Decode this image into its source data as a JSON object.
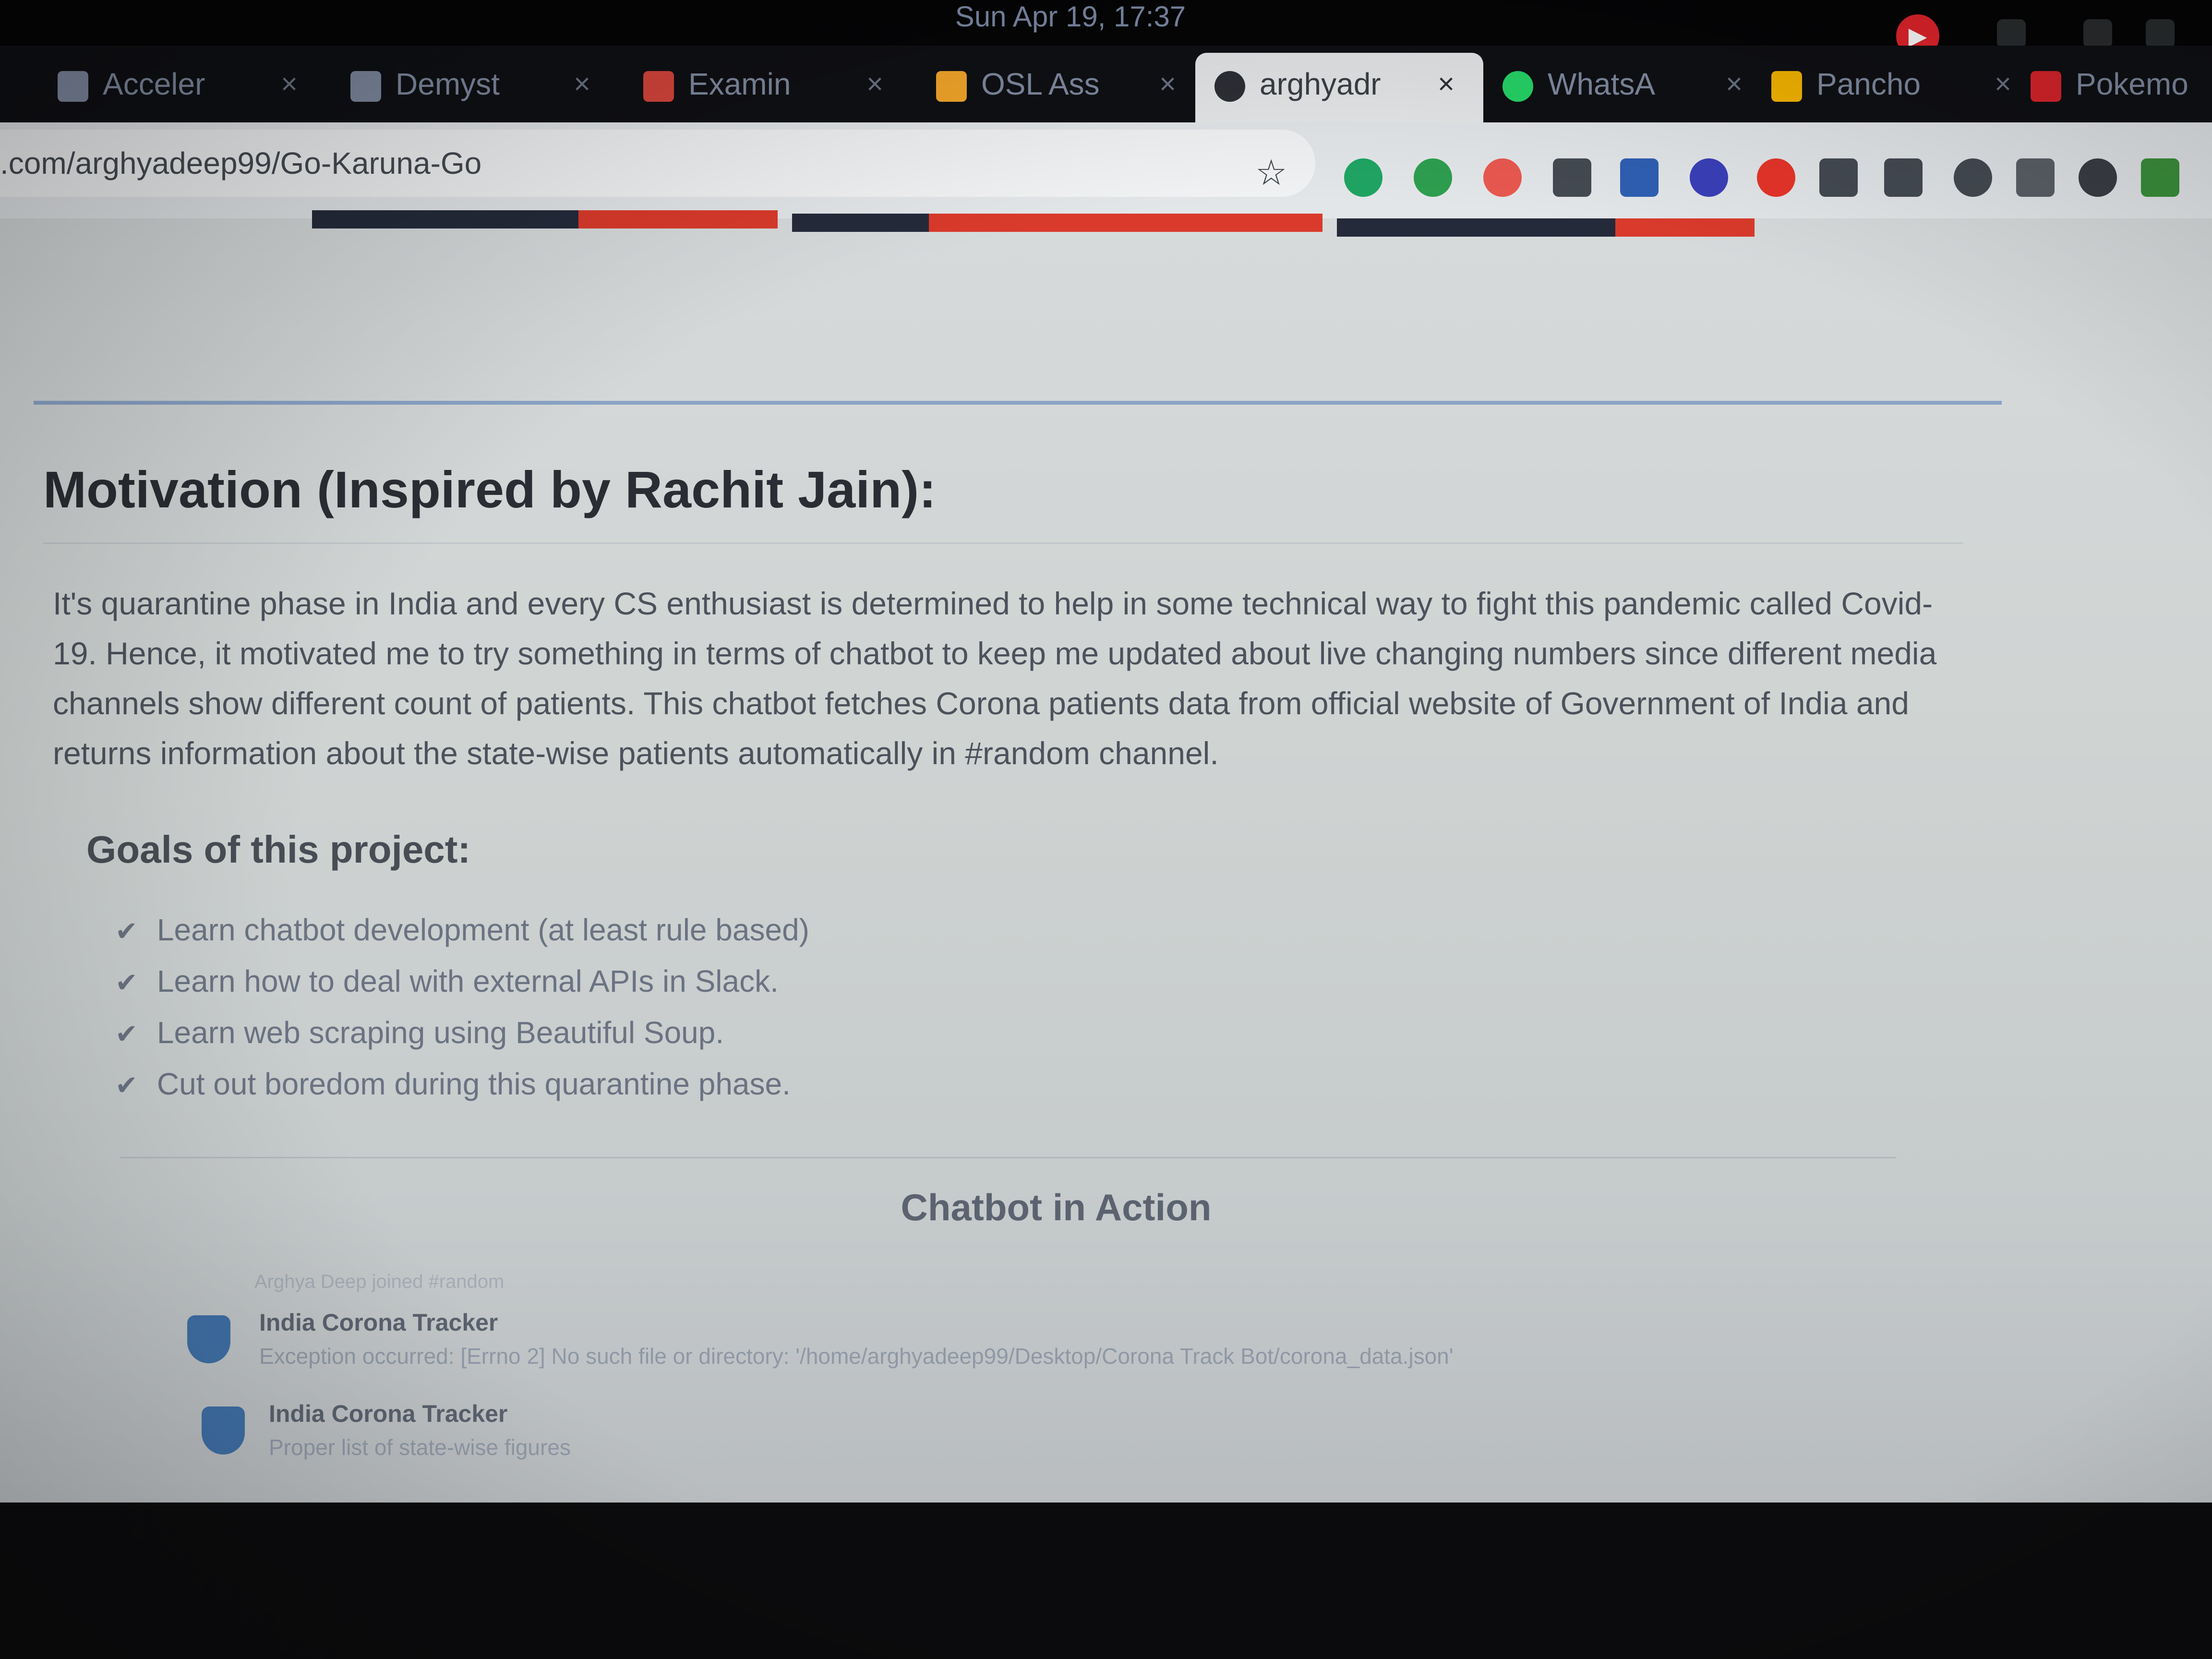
{
  "system": {
    "clock": "Sun Apr 19, 17:37"
  },
  "tabs": [
    {
      "label": "Acceler",
      "favicon_color": "#7f8aa0"
    },
    {
      "label": "Demyst",
      "favicon_color": "#7f8aa0"
    },
    {
      "label": "Examin",
      "favicon_color": "#d5453b"
    },
    {
      "label": "OSL Ass",
      "favicon_color": "#f3a62a"
    },
    {
      "label": "arghyadr",
      "favicon_color": "#2c2f35",
      "active": true
    },
    {
      "label": "WhatsA",
      "favicon_color": "#25d366"
    },
    {
      "label": "Pancho",
      "favicon_color": "#f4b400"
    },
    {
      "label": "Pokemo",
      "favicon_color": "#d8242b"
    }
  ],
  "address_bar": {
    "url": ".com/arghyadeep99/Go-Karuna-Go"
  },
  "extensions": [
    "#1fa463",
    "#2e9e4f",
    "#e8584f",
    "#444a52",
    "#2f5fb3",
    "#3a3fb8",
    "#e6342a",
    "#444a52",
    "#444a52",
    "#444a52",
    "#5a5f66",
    "#3a3d44",
    "#3a8f3a"
  ],
  "content": {
    "motivation_title": "Motivation (Inspired by Rachit Jain):",
    "motivation_text": "It's quarantine phase in India and every CS enthusiast is determined to help in some technical way to fight this pandemic called Covid-19. Hence, it motivated me to try something in terms of chatbot to keep me updated about live changing numbers since different media channels show different count of patients. This chatbot fetches Corona patients data from official website of Government of India and returns information about the state-wise patients automatically in #random channel.",
    "goals_title": "Goals of this project:",
    "goals": [
      "Learn chatbot development (at least rule based)",
      "Learn how to deal with external APIs in Slack.",
      "Learn web scraping using Beautiful Soup.",
      "Cut out boredom during this quarantine phase."
    ],
    "chatbot_title": "Chatbot in Action"
  },
  "slack": {
    "joined": "Arghya Deep joined #random",
    "messages": [
      {
        "name": "India Corona Tracker",
        "text": "Exception occurred: [Errno 2] No such file or directory: '/home/arghyadeep99/Desktop/Corona Track Bot/corona_data.json'"
      },
      {
        "name": "India Corona Tracker",
        "text": "Proper list of state-wise figures"
      }
    ]
  },
  "colors": {
    "accent_red": "#d93a2b",
    "accent_navy": "#242a3a",
    "rule_blue": "#8aa3c6"
  }
}
